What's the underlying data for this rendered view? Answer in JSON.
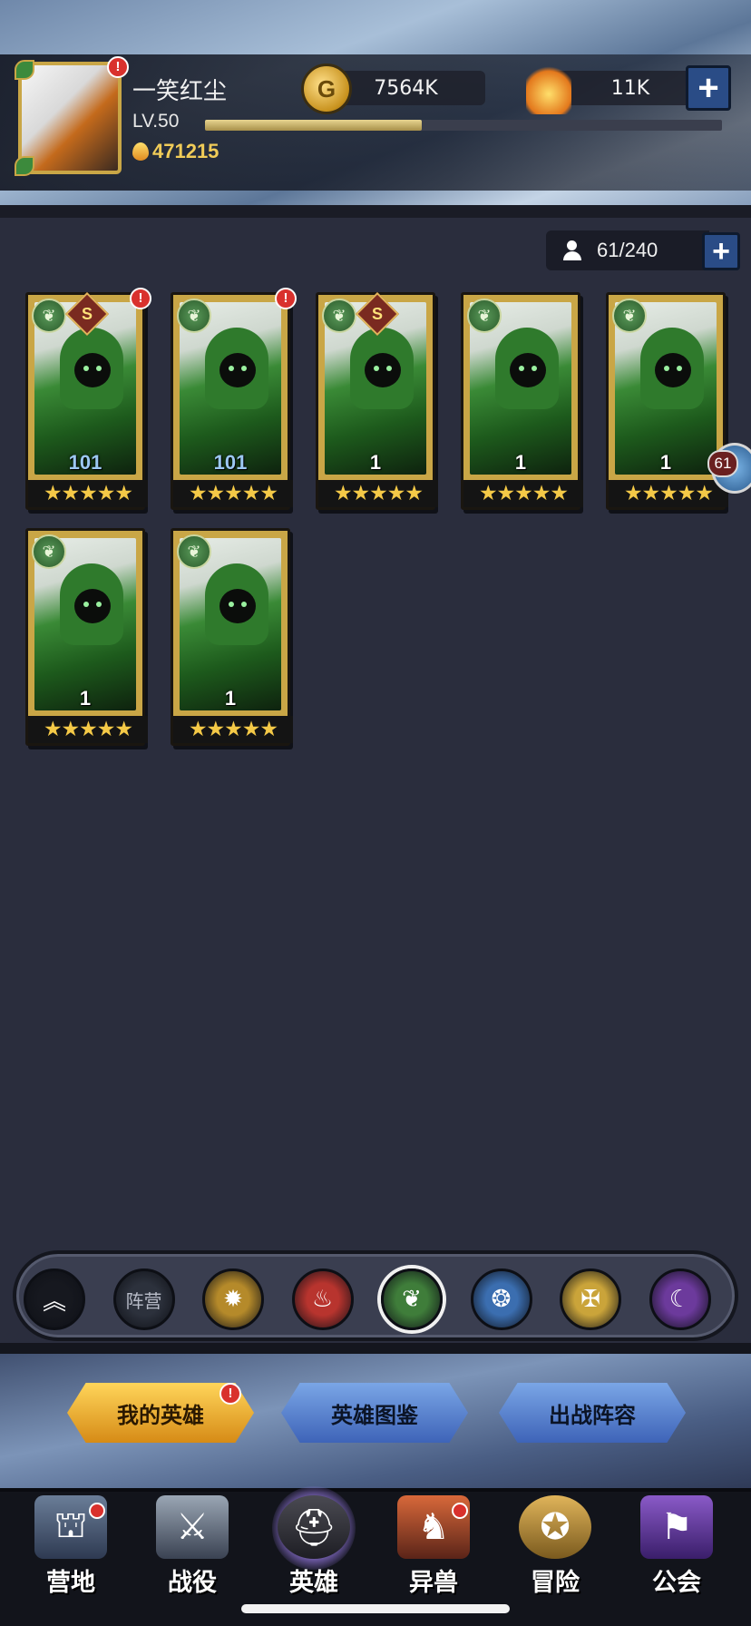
{
  "player": {
    "name": "一笑红尘",
    "level": "LV.50",
    "xp_fraction": 0.42,
    "power": "471215",
    "alert": "!"
  },
  "currency": {
    "gold": "7564K",
    "gems": "11K",
    "gold_icon_letter": "G"
  },
  "roster": {
    "count": "61/240"
  },
  "heroes": [
    {
      "level": "101",
      "rank": "S",
      "stars": "★★★★★",
      "alert": "!"
    },
    {
      "level": "101",
      "rank": "",
      "stars": "★★★★★",
      "alert": "!"
    },
    {
      "level": "1",
      "rank": "S",
      "stars": "★★★★★",
      "alert": ""
    },
    {
      "level": "1",
      "rank": "",
      "stars": "★★★★★",
      "alert": ""
    },
    {
      "level": "1",
      "rank": "",
      "stars": "★★★★★",
      "alert": ""
    },
    {
      "level": "1",
      "rank": "",
      "stars": "★★★★★",
      "alert": ""
    },
    {
      "level": "1",
      "rank": "",
      "stars": "★★★★★",
      "alert": ""
    }
  ],
  "chat": {
    "count": "61"
  },
  "filters": {
    "camp_label": "阵营",
    "items": [
      {
        "icon": "chevron-up-icon",
        "glyph": "︽",
        "color": "#16181f"
      },
      {
        "icon": "camp-text",
        "glyph": "",
        "color": "#2c313c"
      },
      {
        "icon": "sun-icon",
        "glyph": "✹",
        "color": "#b58a2a"
      },
      {
        "icon": "fire-icon",
        "glyph": "♨",
        "color": "#b8342e"
      },
      {
        "icon": "forest-icon",
        "glyph": "❦",
        "color": "#3f7d3a"
      },
      {
        "icon": "water-icon",
        "glyph": "❂",
        "color": "#3b6eb0"
      },
      {
        "icon": "light-icon",
        "glyph": "✠",
        "color": "#caa43a"
      },
      {
        "icon": "dark-icon",
        "glyph": "☾",
        "color": "#6c3a9c"
      }
    ]
  },
  "subtabs": {
    "my_heroes": "我的英雄",
    "hero_codex": "英雄图鉴",
    "battle_lineup": "出战阵容",
    "alert": "!"
  },
  "nav": {
    "camp": "营地",
    "campaign": "战役",
    "heroes": "英雄",
    "beasts": "异兽",
    "adventure": "冒险",
    "guild": "公会"
  },
  "colors": {
    "accent_gold": "#c9a646",
    "alert_red": "#d9312d",
    "button_blue": "#2a4c86"
  }
}
